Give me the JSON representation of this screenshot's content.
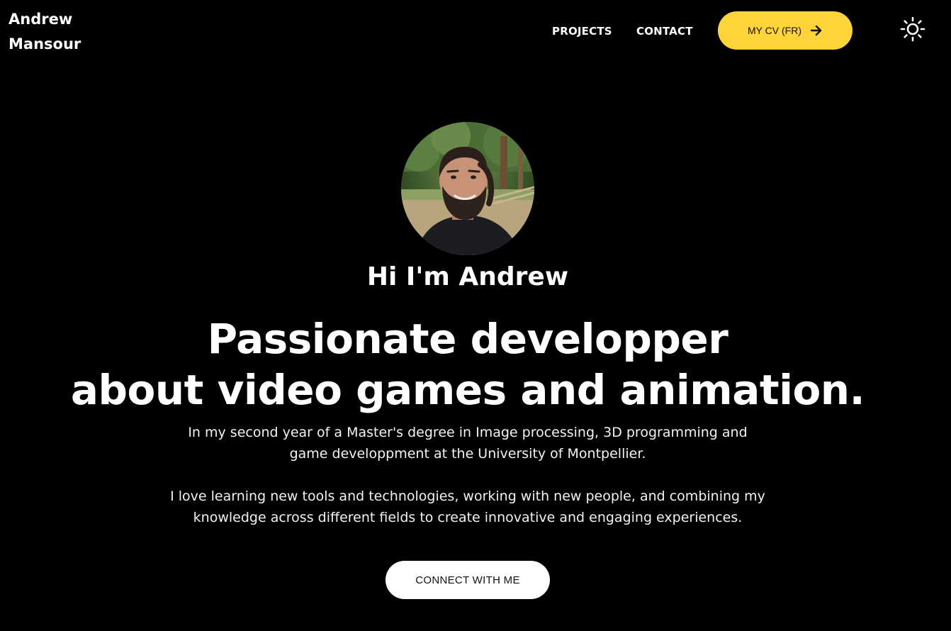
{
  "header": {
    "brand_line1": "Andrew",
    "brand_line2": "Mansour",
    "nav": {
      "projects": "PROJECTS",
      "contact": "CONTACT"
    },
    "cv_button_label": "MY CV (FR)",
    "cv_button_icon": "arrow-right-icon",
    "theme_toggle_icon": "sun-icon"
  },
  "hero": {
    "avatar_alt": "Andrew Mansour portrait",
    "greeting": "Hi I'm Andrew",
    "headline_line1": "Passionate developper",
    "headline_line2": "about video games and animation.",
    "paragraph1": "In my second year of a Master's degree in Image processing, 3D programming and game developpment at the University of Montpellier.",
    "paragraph2": "I love learning new tools and technologies, working with new people, and combining my knowledge across different fields to create innovative and engaging experiences.",
    "connect_button_label": "CONNECT WITH ME"
  },
  "colors": {
    "background": "#000000",
    "text": "#ffffff",
    "accent": "#ffd43a",
    "button_light": "#ffffff"
  }
}
